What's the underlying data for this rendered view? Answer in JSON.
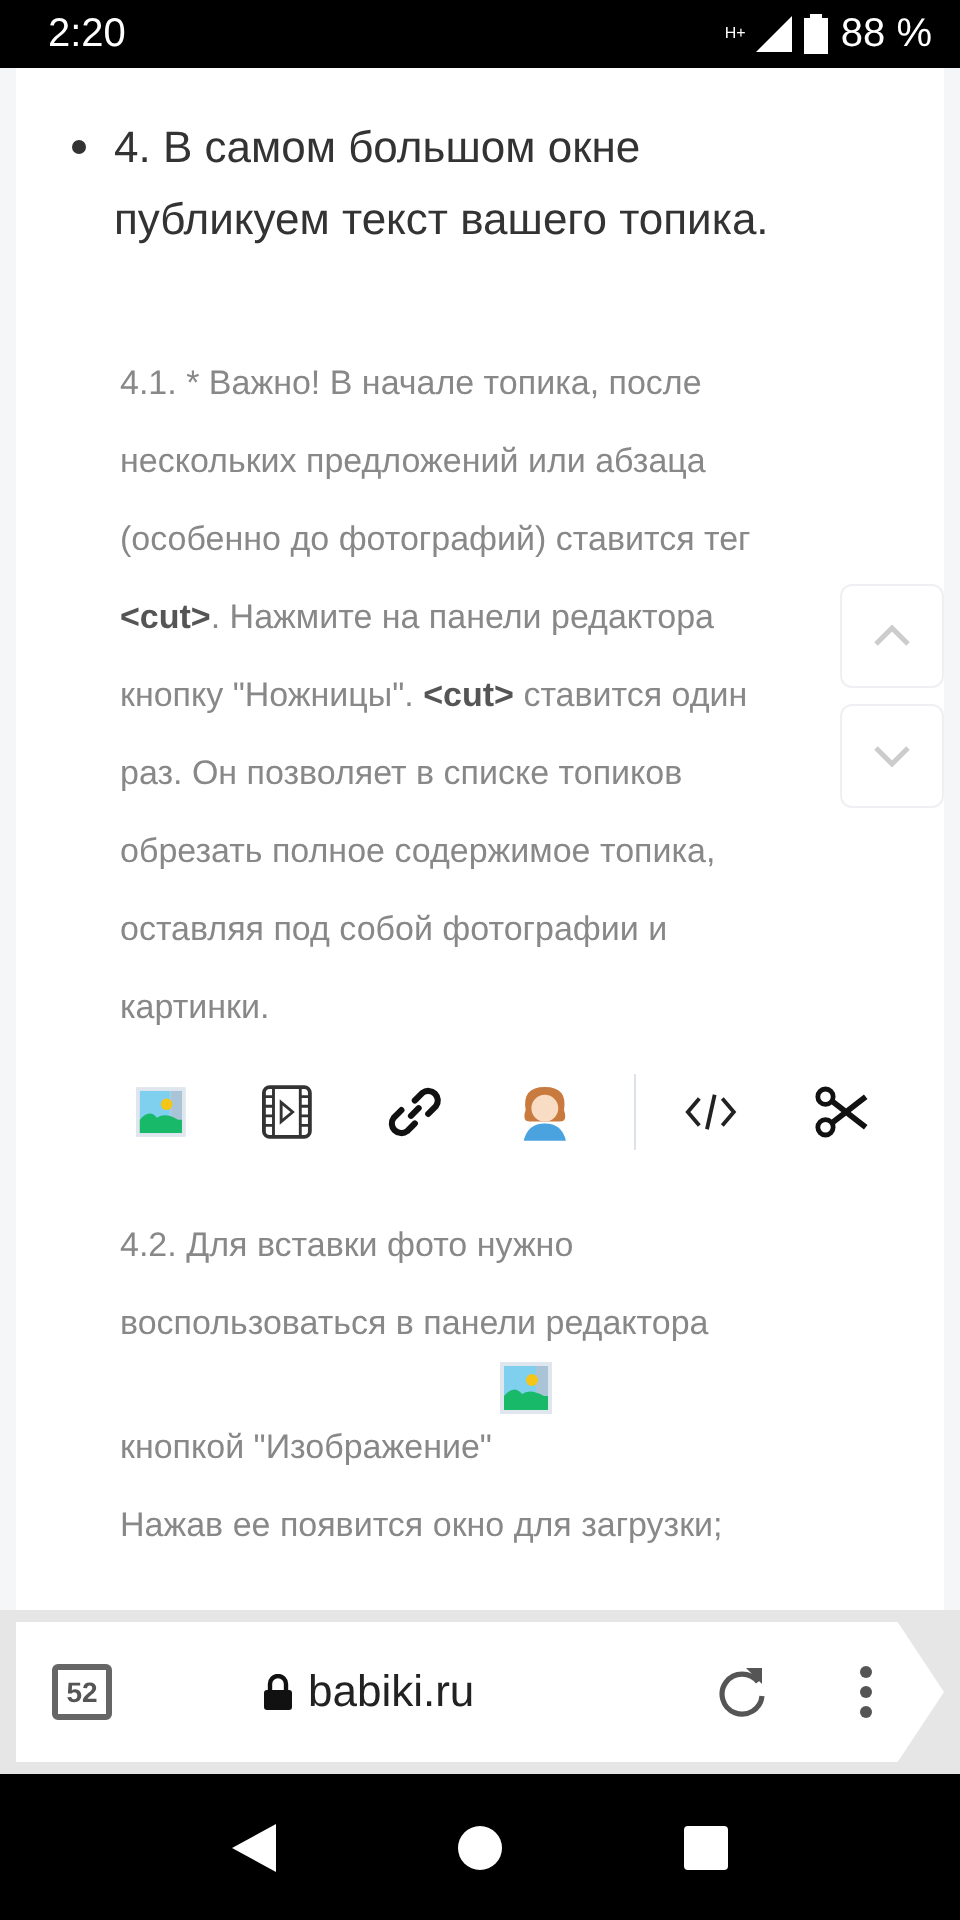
{
  "status_bar": {
    "time": "2:20",
    "network": "H+",
    "battery": "88 %"
  },
  "article": {
    "heading": "4. В самом большом окне публикуем текст вашего топика.",
    "note": "4.1. * Важно! В начале топика, после нескольких предложений или абзаца (особенно до фотографий) ставится тег **<cut>**. Нажмите на панели редактора кнопку \"Ножницы\". **<cut>** ставится один раз. Он позволяет в списке топиков обрезать полное содержимое топика, оставляя под собой фотографии и картинки.",
    "photo_instruction": "4.2. Для вставки фото нужно воспользоваться в панели редактора кнопкой \"Изображение\"",
    "upload_note": "Нажав ее появится окно для загрузки;"
  },
  "browser": {
    "tab_count": "52",
    "url": "babiki.ru"
  }
}
